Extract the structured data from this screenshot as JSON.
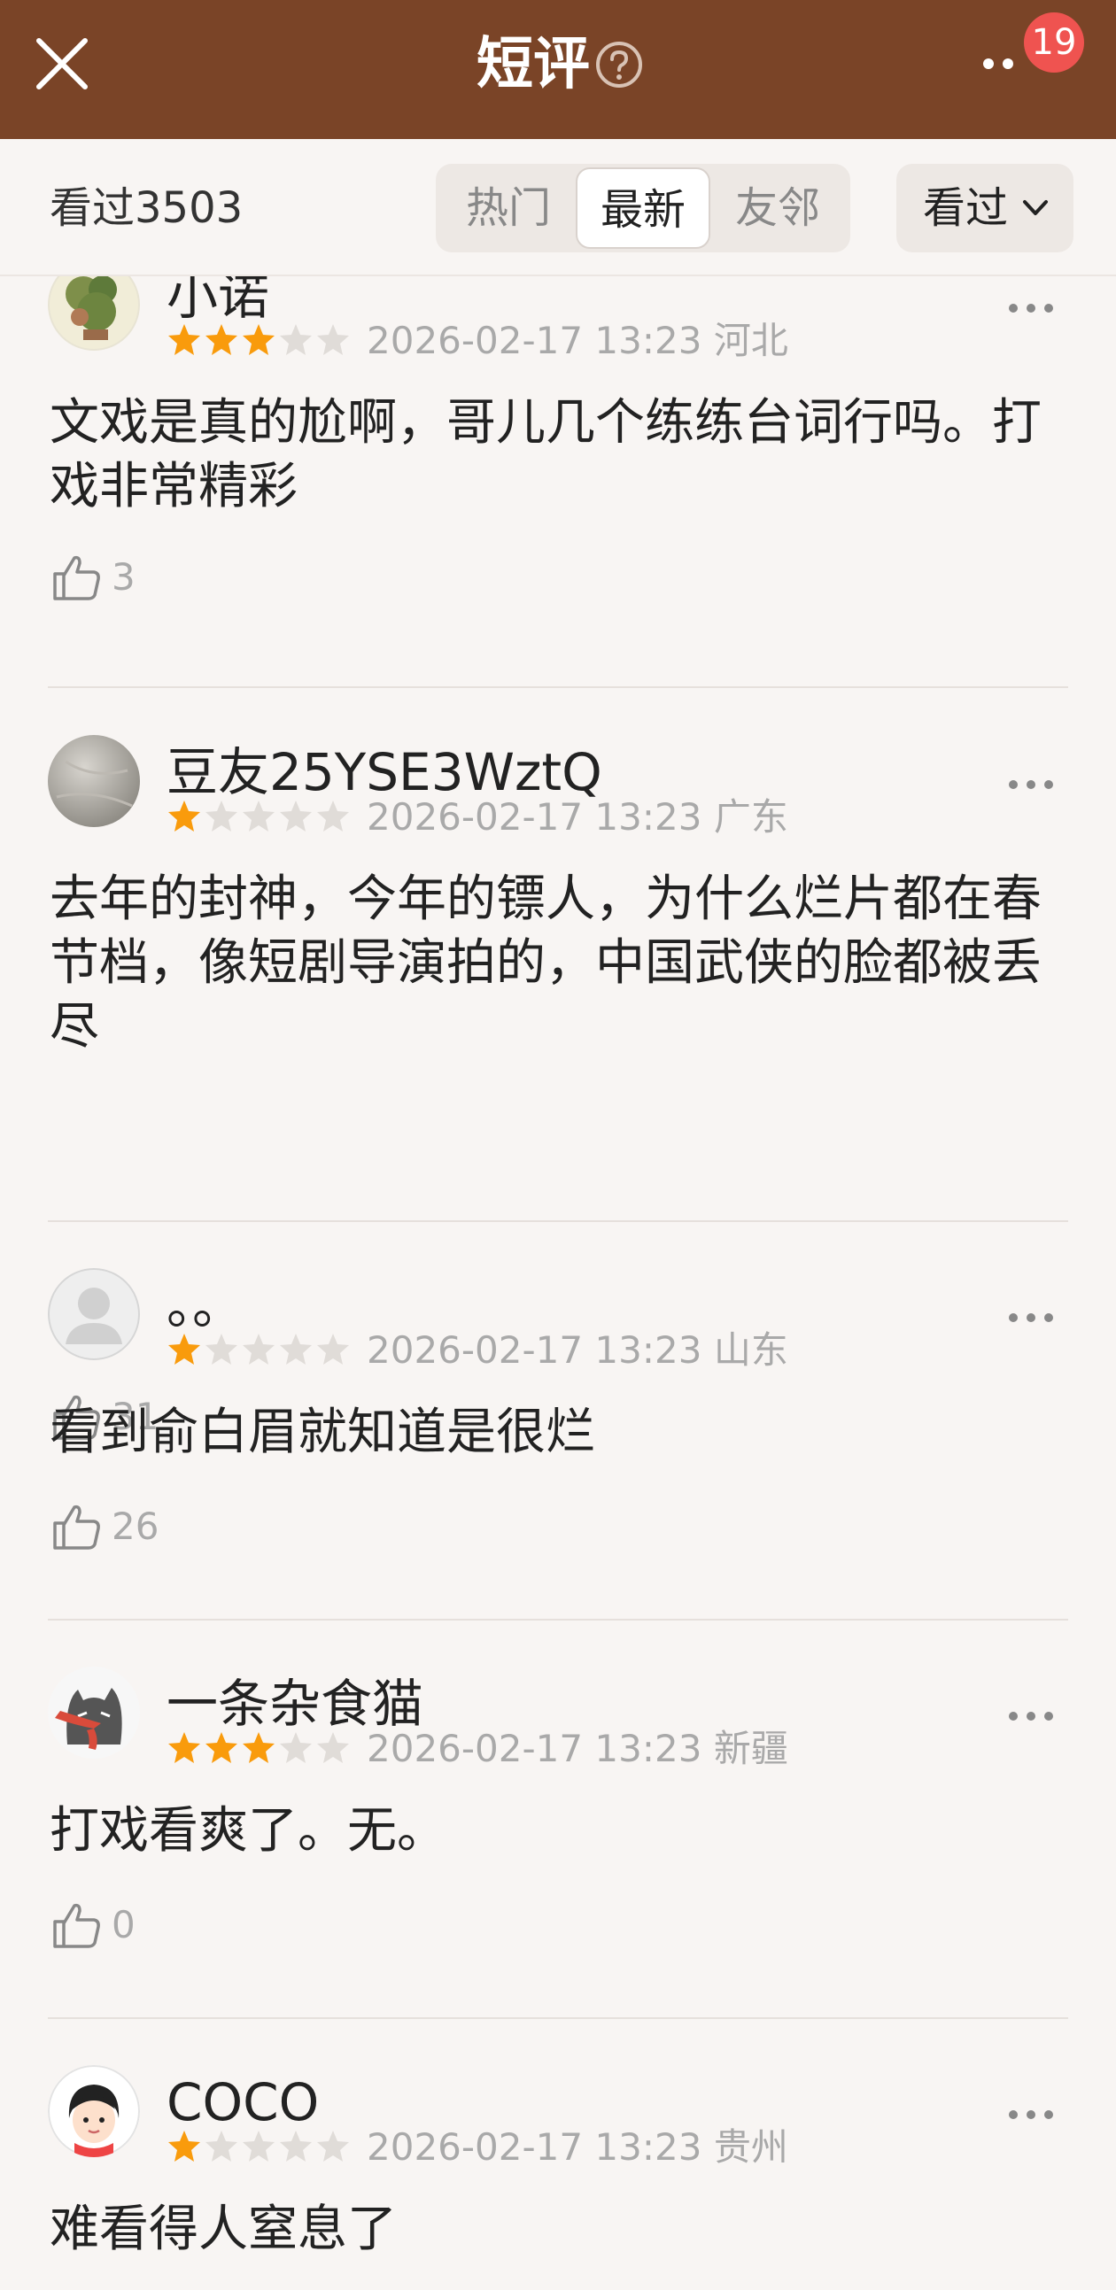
{
  "header": {
    "title": "短评",
    "badge_count": "19"
  },
  "filter": {
    "seen_count": "看过3503",
    "tabs": [
      "热门",
      "最新",
      "友邻"
    ],
    "active_tab": "最新",
    "sort_label": "看过"
  },
  "colors": {
    "header_bg": "#7a4427",
    "star_on": "#f99b0c",
    "star_off": "#e0dcd8",
    "badge": "#ef5350"
  },
  "comments": [
    {
      "user": "小诺",
      "rating": 3,
      "time": "2026-02-17 13:23",
      "region": "河北",
      "text": "文戏是真的尬啊，哥儿几个练练台词行吗。打戏非常精彩",
      "likes": "3"
    },
    {
      "user": "豆友25YSE3WztQ",
      "rating": 1,
      "time": "2026-02-17 13:23",
      "region": "广东",
      "text": "去年的封神，今年的镖人，为什么烂片都在春节档，像短剧导演拍的，中国武侠的脸都被丢尽",
      "likes": "31"
    },
    {
      "user": "。。",
      "rating": 1,
      "time": "2026-02-17 13:23",
      "region": "山东",
      "text": "看到俞白眉就知道是很烂",
      "likes": "26"
    },
    {
      "user": "一条杂食猫",
      "rating": 3,
      "time": "2026-02-17 13:23",
      "region": "新疆",
      "text": "打戏看爽了。无。",
      "likes": "0"
    },
    {
      "user": "COCO",
      "rating": 1,
      "time": "2026-02-17 13:23",
      "region": "贵州",
      "text": "难看得人窒息了",
      "likes": ""
    }
  ]
}
